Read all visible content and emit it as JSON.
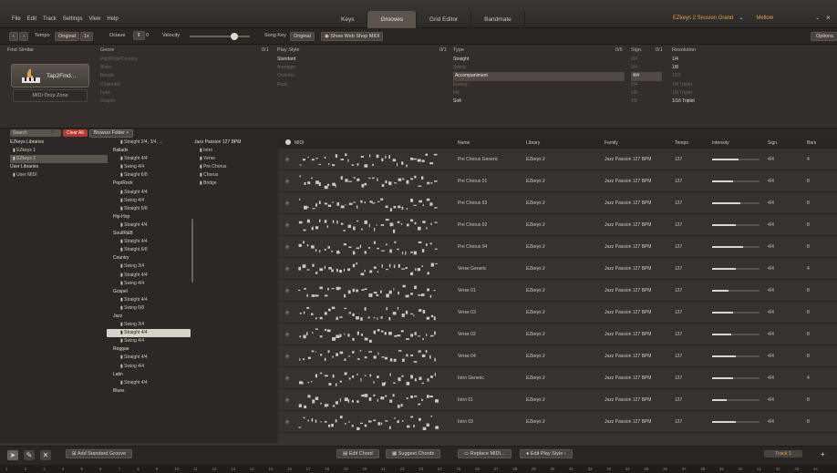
{
  "menu": [
    "File",
    "Edit",
    "Track",
    "Settings",
    "View",
    "Help"
  ],
  "tabs": [
    "Keys",
    "Grooves",
    "Grid Editor",
    "Bandmate"
  ],
  "active_tab": 1,
  "preset": {
    "instrument": "EZkeys 2 Session Grand",
    "style": "Mellow"
  },
  "toolbar": {
    "tempo_label": "Tempo",
    "tempo_value": "Original",
    "tempo_mult": "1x",
    "octave_label": "Octave",
    "octave_value": "0",
    "velocity_label": "Velocity",
    "songkey_label": "Song Key",
    "songkey_value": "Original",
    "webshop": "Show Web Shop MIDI",
    "options": "Options"
  },
  "filters": {
    "find_similar": "Find Similar",
    "tap2find": "Tap2Find...",
    "drop_zone": "MIDI Drop Zone",
    "genre_head": "Genre",
    "genre_count": "0/1",
    "genres": [
      {
        "t": "Pop/Rock/Country",
        "on": false
      },
      {
        "t": "Blues",
        "on": false
      },
      {
        "t": "Boogie",
        "on": false
      },
      {
        "t": "Cinematic",
        "on": false
      },
      {
        "t": "Funk",
        "on": false
      },
      {
        "t": "Gospel",
        "on": false
      }
    ],
    "play_style_head": "Play Style",
    "play_style_count": "0/1",
    "play_styles": [
      {
        "t": "Standard",
        "on": true
      },
      {
        "t": "Arpeggio",
        "on": false
      },
      {
        "t": "Ostinato",
        "on": false
      },
      {
        "t": "Pads",
        "on": false
      }
    ],
    "type_head": "Type",
    "type_count": "0/6",
    "types": [
      {
        "t": "Straight",
        "on": true
      },
      {
        "t": "Swing",
        "on": false
      },
      {
        "t": "Accompaniment",
        "on": true,
        "sel": true
      },
      {
        "t": "Ending",
        "on": false
      },
      {
        "t": "Fill",
        "on": false
      },
      {
        "t": "Soft",
        "on": true
      }
    ],
    "sign_head": "Sign.",
    "sign_count": "0/1",
    "signs": [
      {
        "t": "2/4",
        "on": false
      },
      {
        "t": "3/4",
        "on": false
      },
      {
        "t": "4/4",
        "on": true,
        "sel": true
      },
      {
        "t": "5/4",
        "on": false
      },
      {
        "t": "6/8",
        "on": false
      },
      {
        "t": "7/8",
        "on": false
      }
    ],
    "res_head": "Resolution",
    "resolutions": [
      {
        "t": "1/4",
        "on": true
      },
      {
        "t": "1/8",
        "on": true
      },
      {
        "t": "1/16",
        "on": false
      },
      {
        "t": "1/4 Triplet",
        "on": false
      },
      {
        "t": "1/8 Triplet",
        "on": false
      },
      {
        "t": "1/16 Triplet",
        "on": true
      }
    ]
  },
  "search": {
    "placeholder": "Search",
    "clear": "Clear All",
    "browser_folder": "Browser Folder"
  },
  "libraries": {
    "head": "EZkeys Libraries",
    "items": [
      "EZkeys 1",
      "EZkeys 2"
    ],
    "selected": 1,
    "user_head": "User Libraries",
    "user_items": [
      "User MIDI"
    ]
  },
  "tree": [
    {
      "k": "leaf",
      "t": "Straight 2/4, 3/4, ..."
    },
    {
      "k": "grp",
      "t": "Ballads"
    },
    {
      "k": "leaf",
      "t": "Straight 4/4"
    },
    {
      "k": "leaf",
      "t": "Swing 4/4"
    },
    {
      "k": "leaf",
      "t": "Straight 6/8"
    },
    {
      "k": "grp",
      "t": "Pop/Rock"
    },
    {
      "k": "leaf",
      "t": "Straight 4/4"
    },
    {
      "k": "leaf",
      "t": "Swing 4/4"
    },
    {
      "k": "leaf",
      "t": "Straight 6/8"
    },
    {
      "k": "grp",
      "t": "Hip-Hop"
    },
    {
      "k": "leaf",
      "t": "Straight 4/4"
    },
    {
      "k": "grp",
      "t": "Soul/R&B"
    },
    {
      "k": "leaf",
      "t": "Straight 4/4"
    },
    {
      "k": "leaf",
      "t": "Straight 6/8"
    },
    {
      "k": "grp",
      "t": "Country"
    },
    {
      "k": "leaf",
      "t": "Swing 3/4"
    },
    {
      "k": "leaf",
      "t": "Straight 4/4"
    },
    {
      "k": "leaf",
      "t": "Swing 4/4"
    },
    {
      "k": "grp",
      "t": "Gospel"
    },
    {
      "k": "leaf",
      "t": "Straight 4/4"
    },
    {
      "k": "leaf",
      "t": "Swing 6/8"
    },
    {
      "k": "grp",
      "t": "Jazz"
    },
    {
      "k": "leaf",
      "t": "Swing 3/4"
    },
    {
      "k": "leaf",
      "t": "Straight 4/4",
      "sel": true
    },
    {
      "k": "leaf",
      "t": "Swing 4/4"
    },
    {
      "k": "grp",
      "t": "Reggae"
    },
    {
      "k": "leaf",
      "t": "Straight 4/4"
    },
    {
      "k": "leaf",
      "t": "Swing 4/4"
    },
    {
      "k": "grp",
      "t": "Latin"
    },
    {
      "k": "leaf",
      "t": "Straight 4/4"
    },
    {
      "k": "grp",
      "t": "Blues"
    }
  ],
  "parts": {
    "head": "Jazz Passion 127 BPM",
    "items": [
      "Intro",
      "Verse",
      "Pre Chorus",
      "Chorus",
      "Bridge"
    ]
  },
  "grid_head": {
    "midi": "MIDI",
    "name": "Name",
    "library": "Library",
    "family": "Family",
    "tempo": "Tempo",
    "intensity": "Intensity",
    "sign": "Sign.",
    "bars": "Bars"
  },
  "rows": [
    {
      "name": "Pre Chorus Generic",
      "library": "EZkeys 2",
      "family": "Jazz Passion 127 BPM",
      "tempo": "127",
      "intensity": 0.55,
      "sign": "4/4",
      "bars": "4"
    },
    {
      "name": "Pre Chorus 01",
      "library": "EZkeys 2",
      "family": "Jazz Passion 127 BPM",
      "tempo": "127",
      "intensity": 0.45,
      "sign": "4/4",
      "bars": "8"
    },
    {
      "name": "Pre Chorus 03",
      "library": "EZkeys 2",
      "family": "Jazz Passion 127 BPM",
      "tempo": "127",
      "intensity": 0.6,
      "sign": "4/4",
      "bars": "8"
    },
    {
      "name": "Pre Chorus 02",
      "library": "EZkeys 2",
      "family": "Jazz Passion 127 BPM",
      "tempo": "127",
      "intensity": 0.5,
      "sign": "4/4",
      "bars": "8"
    },
    {
      "name": "Pre Chorus 04",
      "library": "EZkeys 2",
      "family": "Jazz Passion 127 BPM",
      "tempo": "127",
      "intensity": 0.65,
      "sign": "4/4",
      "bars": "8"
    },
    {
      "name": "Verse Generic",
      "library": "EZkeys 2",
      "family": "Jazz Passion 127 BPM",
      "tempo": "127",
      "intensity": 0.5,
      "sign": "4/4",
      "bars": "4"
    },
    {
      "name": "Verse 01",
      "library": "EZkeys 2",
      "family": "Jazz Passion 127 BPM",
      "tempo": "127",
      "intensity": 0.35,
      "sign": "4/4",
      "bars": "8"
    },
    {
      "name": "Verse 03",
      "library": "EZkeys 2",
      "family": "Jazz Passion 127 BPM",
      "tempo": "127",
      "intensity": 0.45,
      "sign": "4/4",
      "bars": "8"
    },
    {
      "name": "Verse 02",
      "library": "EZkeys 2",
      "family": "Jazz Passion 127 BPM",
      "tempo": "127",
      "intensity": 0.4,
      "sign": "4/4",
      "bars": "8"
    },
    {
      "name": "Verse 04",
      "library": "EZkeys 2",
      "family": "Jazz Passion 127 BPM",
      "tempo": "127",
      "intensity": 0.5,
      "sign": "4/4",
      "bars": "8"
    },
    {
      "name": "Intro Generic",
      "library": "EZkeys 2",
      "family": "Jazz Passion 127 BPM",
      "tempo": "127",
      "intensity": 0.45,
      "sign": "4/4",
      "bars": "4"
    },
    {
      "name": "Intro 01",
      "library": "EZkeys 2",
      "family": "Jazz Passion 127 BPM",
      "tempo": "127",
      "intensity": 0.3,
      "sign": "4/4",
      "bars": "8"
    },
    {
      "name": "Intro 03",
      "library": "EZkeys 2",
      "family": "Jazz Passion 127 BPM",
      "tempo": "127",
      "intensity": 0.5,
      "sign": "4/4",
      "bars": "8"
    }
  ],
  "bottom": {
    "add_groove": "Add Standard Groove",
    "edit_chord": "Edit Chord",
    "suggest": "Suggest Chords",
    "replace": "Replace MIDI...",
    "edit_play": "Edit Play Style",
    "track": "Track 1"
  },
  "ruler": [
    "1",
    "2",
    "3",
    "4",
    "5",
    "6",
    "7",
    "8",
    "9",
    "10",
    "11",
    "12",
    "13",
    "14",
    "15",
    "16",
    "17",
    "18",
    "19",
    "20",
    "21",
    "22",
    "23",
    "24",
    "25",
    "26",
    "27",
    "28",
    "29",
    "30",
    "31",
    "32",
    "33",
    "34",
    "35",
    "36",
    "37",
    "38",
    "39",
    "40",
    "41",
    "42",
    "43",
    "44"
  ],
  "colors": {
    "accent": "#e8a040",
    "clear": "#b8382e",
    "bg": "#3a3531"
  }
}
